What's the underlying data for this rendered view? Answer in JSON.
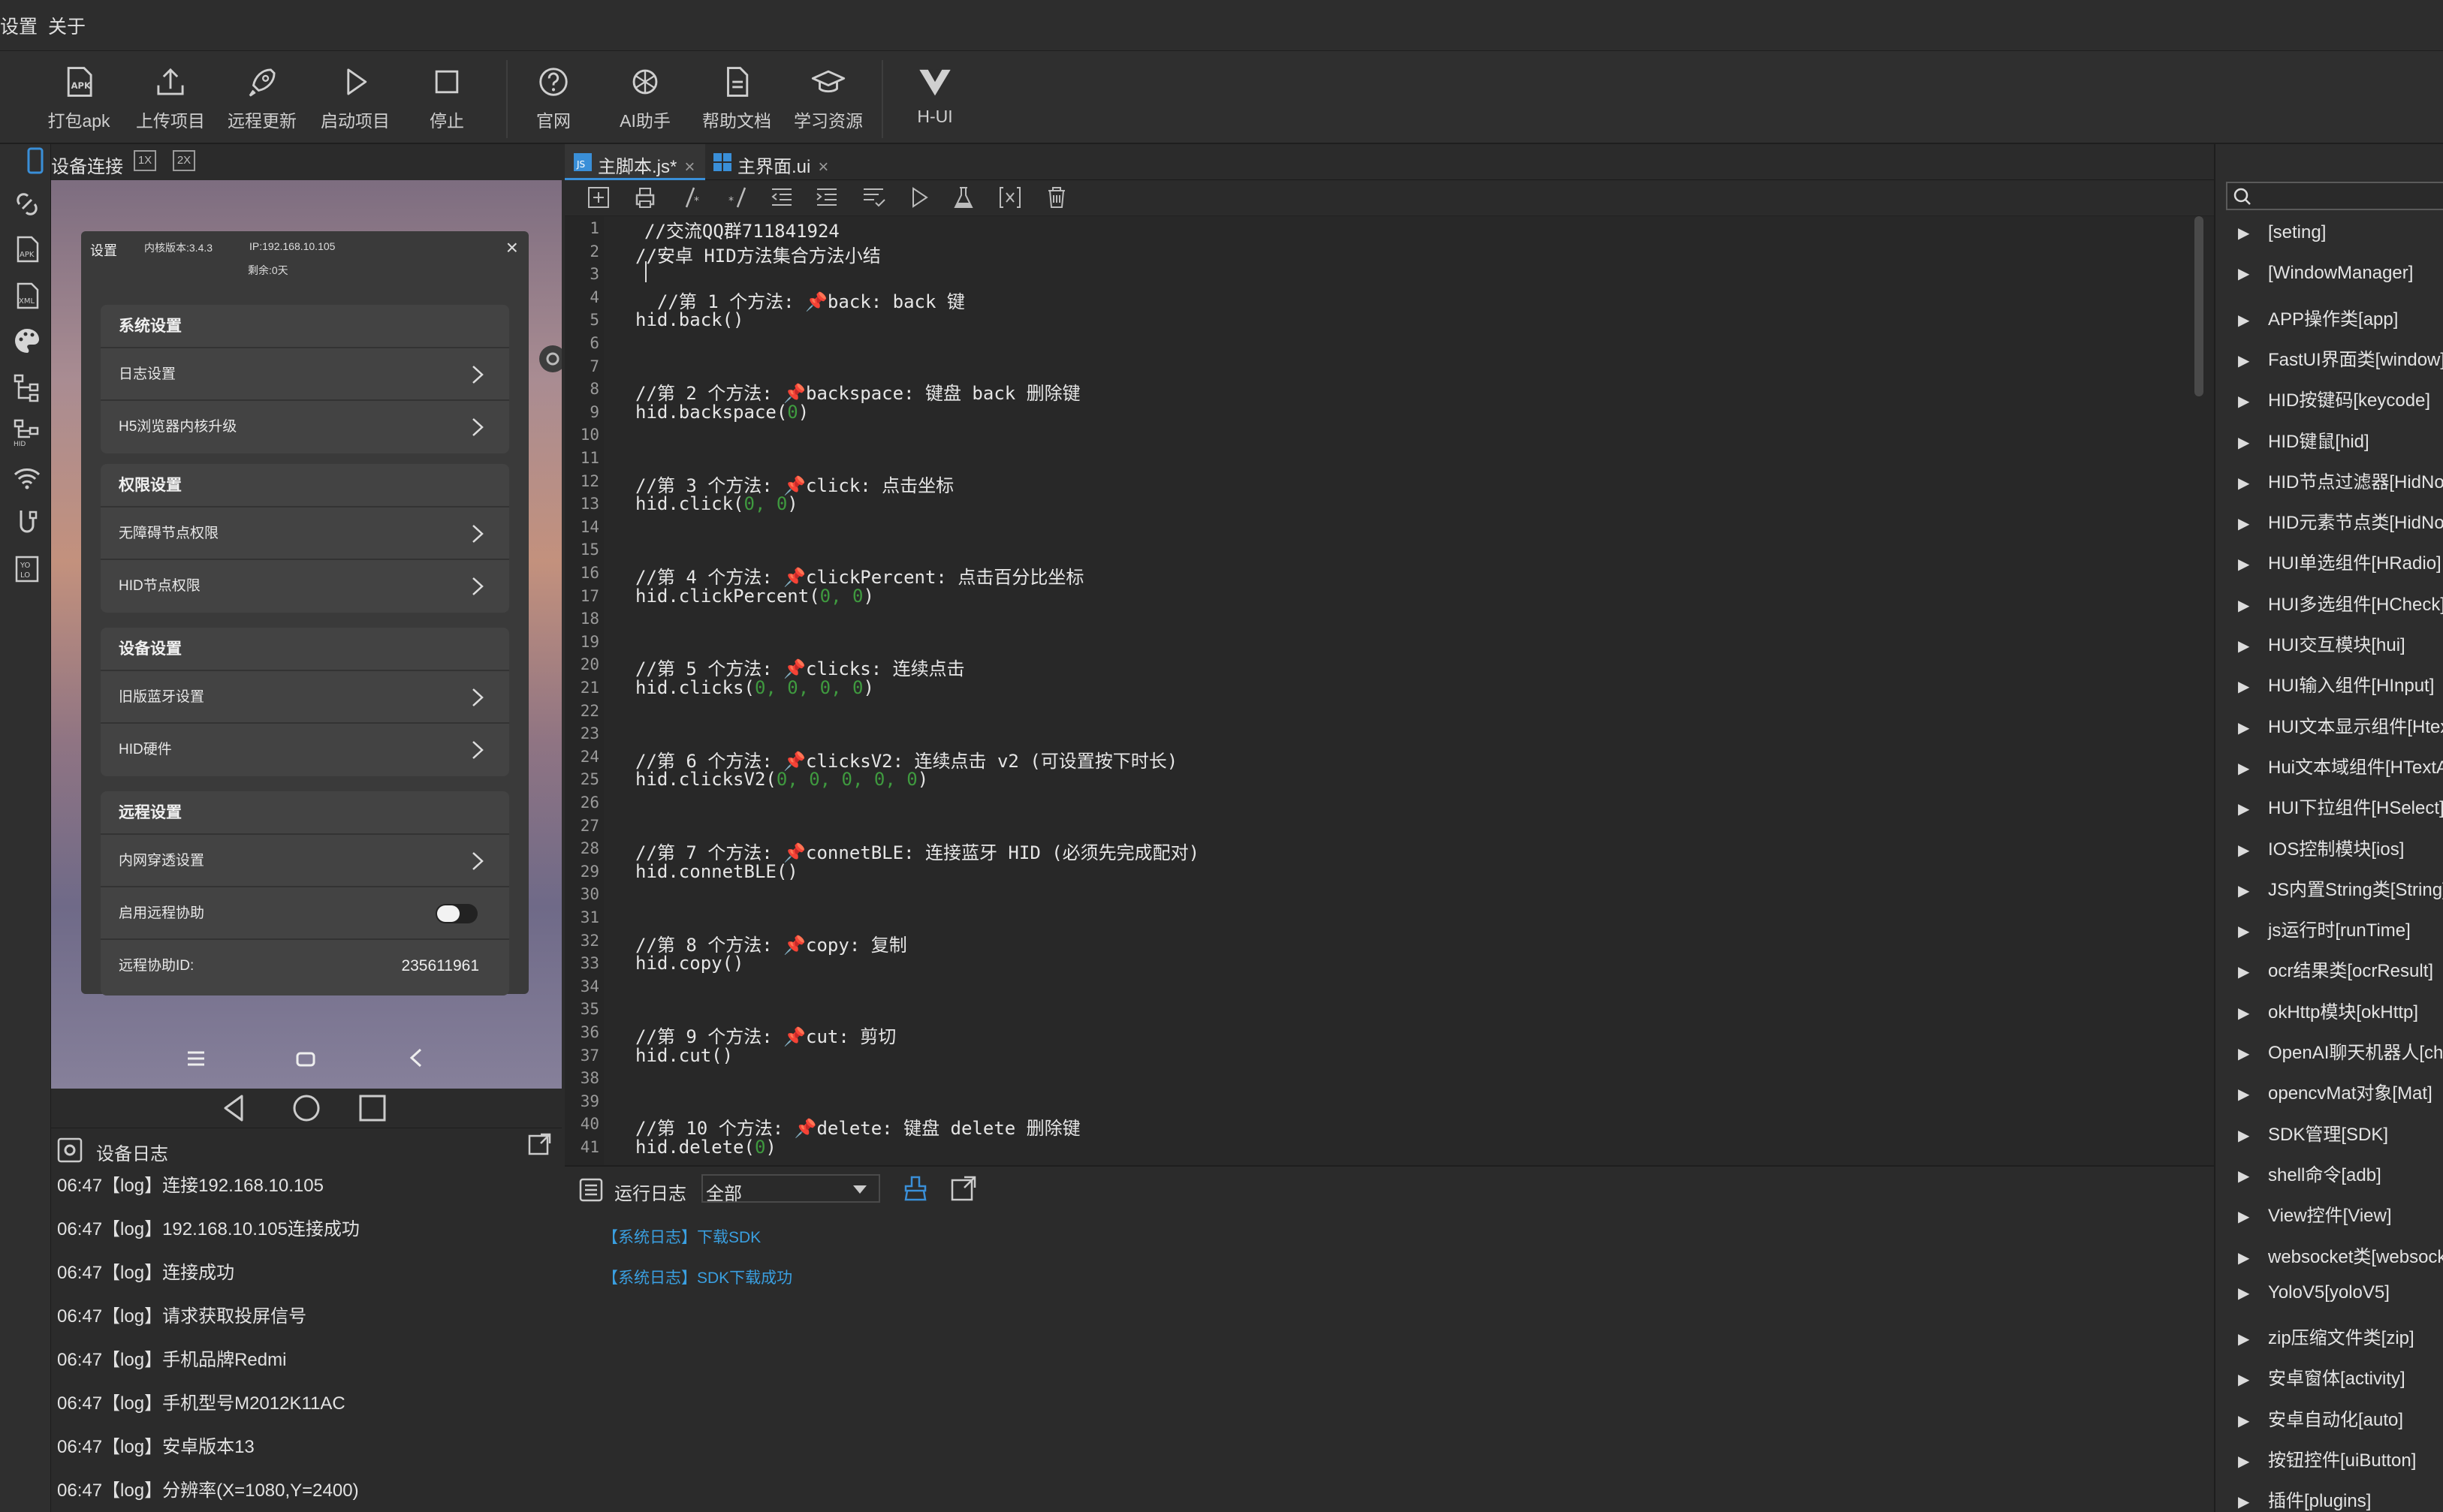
{
  "menubar": {
    "items": [
      "设置",
      "关于"
    ]
  },
  "toolbar": {
    "buttons": [
      {
        "label": "打包apk",
        "icon": "apk-package-icon"
      },
      {
        "label": "上传项目",
        "icon": "upload-icon"
      },
      {
        "label": "远程更新",
        "icon": "rocket-icon"
      },
      {
        "label": "启动项目",
        "icon": "play-icon"
      },
      {
        "label": "停止",
        "icon": "stop-icon"
      },
      {
        "label": "官网",
        "icon": "help-circle-icon"
      },
      {
        "label": "AI助手",
        "icon": "openai-icon"
      },
      {
        "label": "帮助文档",
        "icon": "document-icon"
      },
      {
        "label": "学习资源",
        "icon": "graduation-cap-icon"
      },
      {
        "label": "H-UI",
        "icon": "vue-logo-icon"
      }
    ]
  },
  "device_panel": {
    "title": "设备连接",
    "zoom_1x": "1X",
    "zoom_2x": "2X",
    "settings": {
      "title": "设置",
      "version": "内核版本:3.4.3",
      "ip": "IP:192.168.10.105",
      "remaining": "剩余:0天",
      "groups": [
        {
          "header": "系统设置",
          "rows": [
            {
              "label": "日志设置"
            },
            {
              "label": "H5浏览器内核升级"
            }
          ]
        },
        {
          "header": "权限设置",
          "rows": [
            {
              "label": "无障碍节点权限"
            },
            {
              "label": "HID节点权限"
            }
          ]
        },
        {
          "header": "设备设置",
          "rows": [
            {
              "label": "旧版蓝牙设置"
            },
            {
              "label": "HID硬件"
            }
          ]
        },
        {
          "header": "远程设置",
          "rows": [
            {
              "label": "内网穿透设置"
            },
            {
              "label": "启用远程协助"
            },
            {
              "label": "远程协助ID:",
              "value": "235611961"
            }
          ]
        }
      ]
    }
  },
  "device_log": {
    "title": "设备日志",
    "lines": [
      "06:47【log】连接192.168.10.105",
      "06:47【log】192.168.10.105连接成功",
      "06:47【log】连接成功",
      "06:47【log】请求获取投屏信号",
      "06:47【log】手机品牌Redmi",
      "06:47【log】手机型号M2012K11AC",
      "06:47【log】安卓版本13",
      "06:47【log】分辨率(X=1080,Y=2400)"
    ]
  },
  "editor": {
    "tabs": [
      {
        "label": "主脚本.js*"
      },
      {
        "label": "主界面.ui"
      }
    ],
    "top_comment": "//交流QQ群711841924",
    "line_numbers": [
      "1",
      "2",
      "3",
      "4",
      "5",
      "6",
      "7",
      "8",
      "9",
      "10",
      "11",
      "12",
      "13",
      "14",
      "15",
      "16",
      "17",
      "18",
      "19",
      "20",
      "21",
      "22",
      "23",
      "24",
      "25",
      "26",
      "27",
      "28",
      "29",
      "30",
      "31",
      "32",
      "33",
      "34",
      "35",
      "36",
      "37",
      "38",
      "39",
      "40",
      "41"
    ],
    "lines": [
      {
        "ln": 2,
        "text": "//安卓 HID方法集合方法小结",
        "cm": true
      },
      {
        "ln": 4,
        "text": "  //第 1 个方法: 📌back: back 键",
        "cm": true
      },
      {
        "ln": 5,
        "text": "hid.back()"
      },
      {
        "ln": 8,
        "text": "//第 2 个方法: 📌backspace: 键盘 back 删除键",
        "cm": true
      },
      {
        "ln": 9,
        "code": "hid.backspace(",
        "args": "0",
        "end": ")"
      },
      {
        "ln": 12,
        "text": "//第 3 个方法: 📌click: 点击坐标",
        "cm": true
      },
      {
        "ln": 13,
        "code": "hid.click(",
        "args": "0, 0",
        "end": ")"
      },
      {
        "ln": 16,
        "text": "//第 4 个方法: 📌clickPercent: 点击百分比坐标",
        "cm": true
      },
      {
        "ln": 17,
        "code": "hid.clickPercent(",
        "args": "0, 0",
        "end": ")"
      },
      {
        "ln": 20,
        "text": "//第 5 个方法: 📌clicks: 连续点击",
        "cm": true
      },
      {
        "ln": 21,
        "code": "hid.clicks(",
        "args": "0, 0, 0, 0",
        "end": ")"
      },
      {
        "ln": 24,
        "text": "//第 6 个方法: 📌clicksV2: 连续点击 v2 (可设置按下时长)",
        "cm": true
      },
      {
        "ln": 25,
        "code": "hid.clicksV2(",
        "args": "0, 0, 0, 0, 0",
        "end": ")"
      },
      {
        "ln": 28,
        "text": "//第 7 个方法: 📌connetBLE: 连接蓝牙 HID (必须先完成配对)",
        "cm": true
      },
      {
        "ln": 29,
        "text": "hid.connetBLE()"
      },
      {
        "ln": 32,
        "text": "//第 8 个方法: 📌copy: 复制",
        "cm": true
      },
      {
        "ln": 33,
        "text": "hid.copy()"
      },
      {
        "ln": 36,
        "text": "//第 9 个方法: 📌cut: 剪切",
        "cm": true
      },
      {
        "ln": 37,
        "text": "hid.cut()"
      },
      {
        "ln": 40,
        "text": "//第 10 个方法: 📌delete: 键盘 delete 删除键",
        "cm": true
      },
      {
        "ln": 41,
        "code": "hid.delete(",
        "args": "0",
        "end": ")"
      }
    ]
  },
  "run_log": {
    "title": "运行日志",
    "filter_value": "全部",
    "lines": [
      "【系统日志】下载SDK",
      "【系统日志】SDK下载成功"
    ]
  },
  "api_tree": {
    "items": [
      "[seting]",
      "[WindowManager]",
      "APP操作类[app]",
      "FastUI界面类[window]",
      "HID按键码[keycode]",
      "HID键鼠[hid]",
      "HID节点过滤器[HidNo",
      "HID元素节点类[HidNo",
      "HUI单选组件[HRadio]",
      "HUI多选组件[HCheck]",
      "HUI交互模块[hui]",
      "HUI输入组件[HInput]",
      "HUI文本显示组件[Htex",
      "Hui文本域组件[HTextA",
      "HUI下拉组件[HSelect]",
      "IOS控制模块[ios]",
      "JS内置String类[String]",
      "js运行时[runTime]",
      "ocr结果类[ocrResult]",
      "okHttp模块[okHttp]",
      "OpenAI聊天机器人[cha",
      "opencvMat对象[Mat]",
      "SDK管理[SDK]",
      "shell命令[adb]",
      "View控件[View]",
      "websocket类[websock",
      "YoloV5[yoloV5]",
      "zip压缩文件类[zip]",
      "安卓窗体[activity]",
      "安卓自动化[auto]",
      "按钮控件[uiButton]",
      "插件[plugins]"
    ]
  }
}
